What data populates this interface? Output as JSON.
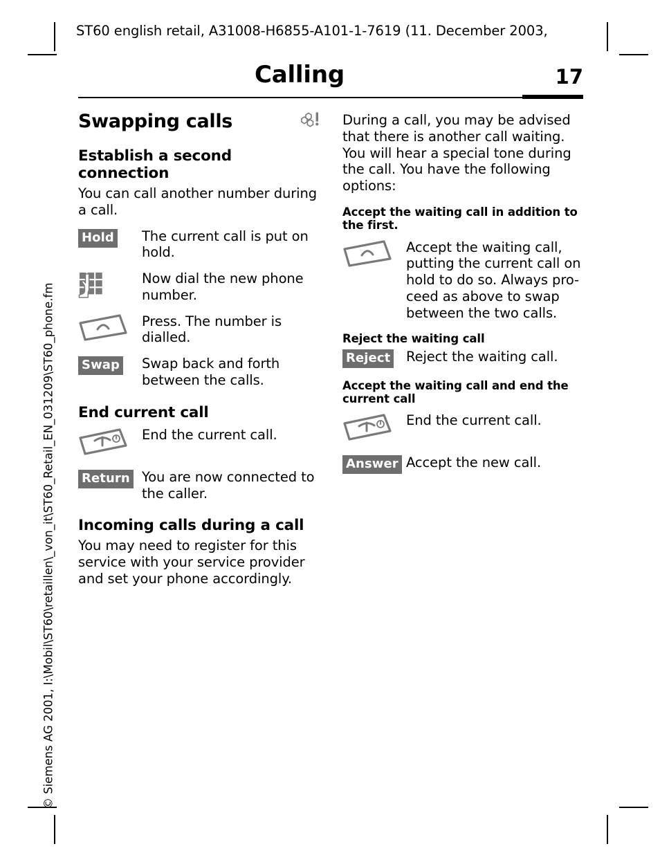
{
  "document": {
    "running_header": "ST60 english retail, A31008-H6855-A101-1-7619 (11. December 2003,",
    "title": "Calling",
    "page_number": "17",
    "spine_note": "© Siemens AG 2001, I:\\Mobil\\ST60\\retaillen\\_von_it\\ST60_Retail_EN_031209\\ST60_phone.fm"
  },
  "left_column": {
    "section_title": "Swapping calls",
    "section_icon": "network-cells-alert-icon",
    "subsection_1": {
      "heading": "Establish a second connection",
      "intro": "You can call another number during a call.",
      "rows": [
        {
          "key_type": "softkey",
          "key_label": "Hold",
          "icon": "",
          "description": "The current call is put on hold."
        },
        {
          "key_type": "icon",
          "key_label": "",
          "icon": "keypad-hand-icon",
          "description": "Now dial the new phone number."
        },
        {
          "key_type": "icon",
          "key_label": "",
          "icon": "call-key-icon",
          "description": "Press. The number is dialled."
        },
        {
          "key_type": "softkey",
          "key_label": "Swap",
          "icon": "",
          "description": "Swap back and forth between the calls."
        }
      ]
    },
    "subsection_2": {
      "heading": "End current call",
      "rows": [
        {
          "key_type": "icon",
          "key_label": "",
          "icon": "end-call-key-icon",
          "description": "End the current call."
        },
        {
          "key_type": "softkey",
          "key_label": "Return",
          "icon": "",
          "description": "You are now connected to the caller."
        }
      ]
    },
    "subsection_3": {
      "heading": "Incoming calls during a call",
      "body": "You may need to register for this service with your service provider and set your phone accordingly."
    }
  },
  "right_column": {
    "intro": "During a call, you may be advised that there is another call waiting. You will hear a special tone during the call. You have the following options:",
    "blocks": [
      {
        "heading": "Accept the waiting call in addition to the first.",
        "rows": [
          {
            "key_type": "icon",
            "key_label": "",
            "icon": "call-key-icon",
            "description": "Accept the waiting call, putting the current call on hold to do so. Always pro-ceed as above to swap between the two calls."
          }
        ]
      },
      {
        "heading": "Reject the waiting call",
        "rows": [
          {
            "key_type": "softkey",
            "key_label": "Reject",
            "icon": "",
            "description": "Reject the waiting call."
          }
        ]
      },
      {
        "heading": "Accept the waiting call and end the current call",
        "rows": [
          {
            "key_type": "icon",
            "key_label": "",
            "icon": "end-call-key-icon",
            "description": "End the current call."
          },
          {
            "key_type": "softkey",
            "key_label": "Answer",
            "icon": "",
            "description": "Accept the new call."
          }
        ]
      }
    ]
  },
  "colors": {
    "softkey_background": "#6e6e6e",
    "softkey_text": "#ffffff",
    "icon_gray": "#7a7a7a",
    "text": "#000000",
    "page_background": "#ffffff"
  }
}
